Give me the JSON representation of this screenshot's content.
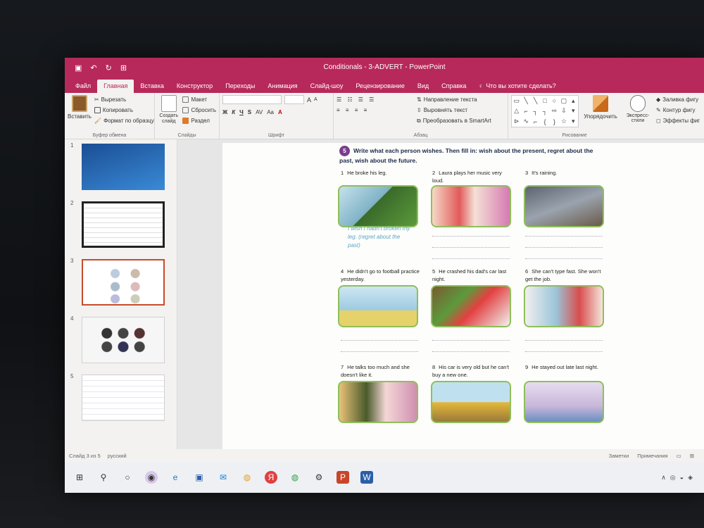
{
  "window": {
    "title": "Conditionals - 3-ADVERT  -  PowerPoint",
    "qat": [
      "save-icon",
      "undo-icon",
      "redo-icon",
      "present-icon"
    ]
  },
  "tabs": [
    {
      "label": "Файл"
    },
    {
      "label": "Главная",
      "active": true
    },
    {
      "label": "Вставка"
    },
    {
      "label": "Конструктор"
    },
    {
      "label": "Переходы"
    },
    {
      "label": "Анимация"
    },
    {
      "label": "Слайд-шоу"
    },
    {
      "label": "Рецензирование"
    },
    {
      "label": "Вид"
    },
    {
      "label": "Справка"
    }
  ],
  "tell_me": "Что вы хотите сделать?",
  "ribbon": {
    "clipboard": {
      "paste": "Вставить",
      "cut": "Вырезать",
      "copy": "Копировать",
      "format_painter": "Формат по образцу",
      "label": "Буфер обмена"
    },
    "slides": {
      "new_slide": "Создать слайд",
      "layout": "Макет",
      "reset": "Сбросить",
      "section": "Раздел",
      "label": "Слайды"
    },
    "font": {
      "bold": "Ж",
      "italic": "К",
      "underline": "Ч",
      "shadow": "S",
      "spacing": "AV",
      "case": "Aa",
      "grow": "A",
      "shrink": "A",
      "label": "Шрифт"
    },
    "paragraph": {
      "text_direction": "Направление текста",
      "align_text": "Выровнять текст",
      "smartart": "Преобразовать в SmartArt",
      "label": "Абзац"
    },
    "drawing": {
      "arrange": "Упорядочить",
      "quick_styles": "Экспресс-стили",
      "fill": "Заливка фигу",
      "outline": "Контур фигу",
      "effects": "Эффекты фиг",
      "label": "Рисование"
    }
  },
  "thumbnails": [
    {
      "num": "1"
    },
    {
      "num": "2"
    },
    {
      "num": "3",
      "selected": true
    },
    {
      "num": "4"
    },
    {
      "num": "5"
    }
  ],
  "slide": {
    "task_number": "5",
    "task_text": "Write what each person wishes. Then fill in: wish about the present, regret about the past, wish about the future.",
    "handwriting": "I wish I hadn't broken my leg. (regret about the past)",
    "items": [
      {
        "num": "1",
        "text": "He broke his leg."
      },
      {
        "num": "2",
        "text": "Laura plays her music very loud."
      },
      {
        "num": "3",
        "text": "It's raining."
      },
      {
        "num": "4",
        "text": "He didn't go to football practice yesterday."
      },
      {
        "num": "5",
        "text": "He crashed his dad's car last night."
      },
      {
        "num": "6",
        "text": "She can't type fast. She won't get the job."
      },
      {
        "num": "7",
        "text": "He talks too much and she doesn't like it."
      },
      {
        "num": "8",
        "text": "His car is very old but he can't buy a new one."
      },
      {
        "num": "9",
        "text": "He stayed out late last night."
      }
    ]
  },
  "status": {
    "slide_info": "Слайд 3 из 5",
    "language": "русский",
    "notes": "Заметки",
    "comments": "Примечания"
  },
  "taskbar": [
    "windows-icon",
    "search-icon",
    "cortana-icon",
    "app-icon",
    "edge-icon",
    "store-icon",
    "mail-icon",
    "chrome-icon",
    "yandex-icon",
    "chrome-alt-icon",
    "settings-icon",
    "powerpoint-icon",
    "word-icon"
  ]
}
